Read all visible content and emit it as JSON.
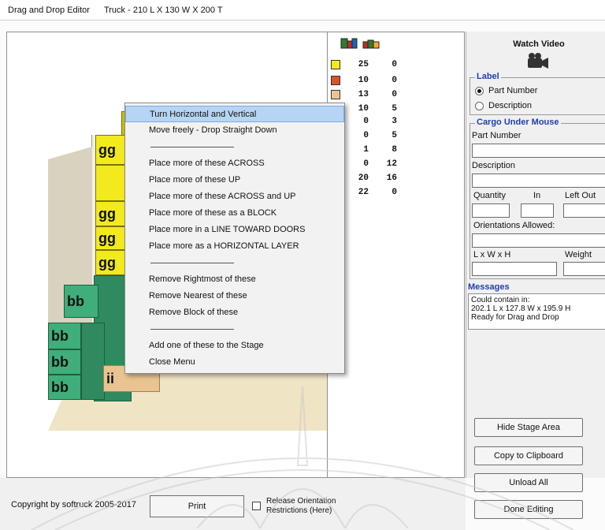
{
  "window": {
    "title": "Drag and Drop Editor",
    "truck_title": "Truck - 210 L X 130 W X 200 T"
  },
  "stage": {
    "boxes": {
      "gg_label": "gg",
      "bb_label": "bb",
      "ii_label": "ii"
    }
  },
  "legend": {
    "rows": [
      {
        "color": "#f3ea1e",
        "a": "25",
        "b": "0"
      },
      {
        "color": "#d9532b",
        "a": "10",
        "b": "0"
      },
      {
        "color": "#e9c492",
        "a": "13",
        "b": "0"
      },
      {
        "color": "#3fae7a",
        "a": "10",
        "b": "5"
      },
      {
        "color": "",
        "a": "0",
        "b": "3"
      },
      {
        "color": "",
        "a": "0",
        "b": "5"
      },
      {
        "color": "",
        "a": "1",
        "b": "8"
      },
      {
        "color": "",
        "a": "0",
        "b": "12"
      },
      {
        "color": "",
        "a": "20",
        "b": "16"
      },
      {
        "color": "",
        "a": "22",
        "b": "0"
      }
    ]
  },
  "context_menu": {
    "items": [
      "Turn Horizontal and Vertical",
      "Move freely - Drop Straight Down",
      "",
      "Place more of these ACROSS",
      "Place more of these UP",
      "Place more of these ACROSS and UP",
      "Place more of these as a BLOCK",
      "Place more in a LINE TOWARD DOORS",
      "Place more as a HORIZONTAL LAYER",
      "",
      "Remove Rightmost of these",
      "Remove Nearest of these",
      "Remove Block of these",
      "",
      "Add one of these to the Stage",
      "Close Menu"
    ]
  },
  "panel": {
    "watch_video": "Watch Video",
    "label_group": "Label",
    "radio_part_number": "Part Number",
    "radio_description": "Description",
    "cargo_group": "Cargo Under Mouse",
    "part_number_label": "Part Number",
    "description_label": "Description",
    "quantity_label": "Quantity",
    "in_label": "In",
    "left_out_label": "Left Out",
    "orientations_label": "Orientations Allowed:",
    "lwh_label": "L x W x H",
    "weight_label": "Weight",
    "messages_title": "Messages",
    "messages": [
      "Could contain in:",
      "202.1 L x 127.8 W x 195.9 H",
      "Ready for Drag and Drop"
    ],
    "hide_stage_button": "Hide Stage Area",
    "copy_button": "Copy to Clipboard",
    "unload_button": "Unload All",
    "done_button": "Done Editing"
  },
  "bottom": {
    "copyright": "Copyright by softruck 2005-2017",
    "print_button": "Print",
    "release_line1": "Release Orientation",
    "release_line2": "Restrictions (Here)"
  }
}
